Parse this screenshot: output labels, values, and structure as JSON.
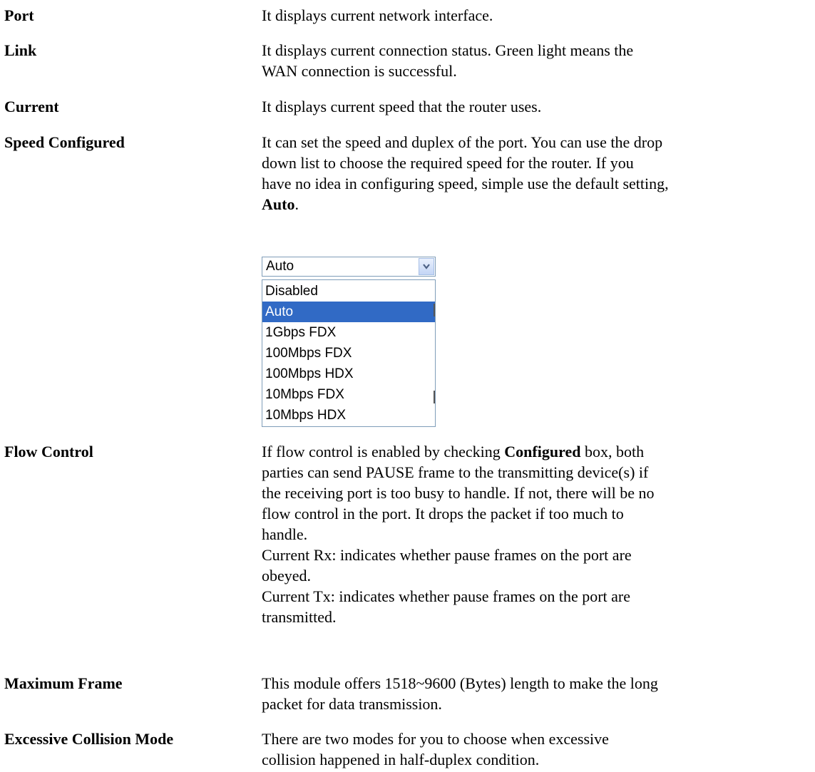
{
  "rows": {
    "port": {
      "term": "Port",
      "lines": [
        "It displays current network interface."
      ]
    },
    "link": {
      "term": "Link",
      "lines": [
        "It displays current connection status. Green light means the",
        "WAN connection is successful."
      ]
    },
    "current": {
      "term": "Current",
      "lines": [
        "It displays current speed that the router uses."
      ]
    },
    "speed_configured": {
      "term": "Speed Configured",
      "lines": [
        "It can set the speed and duplex of the port. You can use the drop",
        "down list to choose the required speed for the router. If you",
        "have no idea in configuring speed, simple use the default setting,"
      ],
      "last_bold": "Auto",
      "last_tail": "."
    },
    "flow_control": {
      "term": "Flow Control",
      "line1_pre": "If flow control is enabled by checking ",
      "line1_bold": "Configured",
      "line1_post": " box, both",
      "lines": [
        "parties can send PAUSE frame to the transmitting device(s) if",
        "the receiving port is too busy to handle. If not, there will be no",
        "flow control in the port. It drops the packet if too much to",
        "handle.",
        "Current Rx: indicates whether pause frames on the port are",
        "obeyed.",
        "Current Tx: indicates whether pause frames on the port are",
        "transmitted."
      ]
    },
    "maximum_frame": {
      "term": "Maximum Frame",
      "lines": [
        "This module offers 1518~9600 (Bytes) length to make the long",
        "packet for data transmission."
      ]
    },
    "excessive_collision": {
      "term": "Excessive Collision Mode",
      "lines": [
        "There are two modes for you to choose when excessive",
        "collision happened in half-duplex condition."
      ]
    }
  },
  "speed_dropdown": {
    "selected_value": "Auto",
    "arrow_icon": "chevron-down-icon",
    "options": [
      "Disabled",
      "Auto",
      "1Gbps FDX",
      "100Mbps FDX",
      "100Mbps HDX",
      "10Mbps FDX",
      "10Mbps HDX"
    ],
    "highlighted_option": "Auto",
    "highlight_color": "#316ac5"
  }
}
